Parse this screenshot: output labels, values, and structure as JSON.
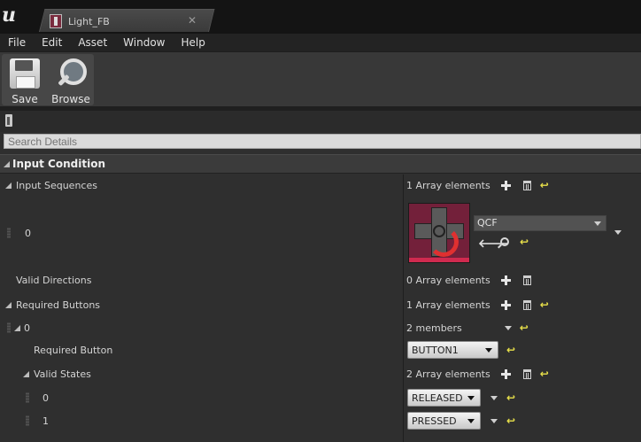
{
  "window": {
    "tab_title": "Light_FB",
    "close_glyph": "✕"
  },
  "menu": [
    "File",
    "Edit",
    "Asset",
    "Window",
    "Help"
  ],
  "toolbar": {
    "save_label": "Save",
    "browse_label": "Browse"
  },
  "details": {
    "search_placeholder": "Search Details",
    "category_title": "Input Condition"
  },
  "rows": {
    "input_sequences": {
      "label": "Input Sequences",
      "value": "1 Array elements"
    },
    "seq_0": {
      "index": "0",
      "asset_name": "QCF"
    },
    "valid_directions": {
      "label": "Valid Directions",
      "value": "0 Array elements"
    },
    "required_buttons": {
      "label": "Required Buttons",
      "value": "1 Array elements"
    },
    "rb_0": {
      "index": "0",
      "value": "2 members"
    },
    "required_button": {
      "label": "Required Button",
      "value": "BUTTON1"
    },
    "valid_states": {
      "label": "Valid States",
      "value": "2 Array elements"
    },
    "vs_0": {
      "index": "0",
      "value": "RELEASED"
    },
    "vs_1": {
      "index": "1",
      "value": "PRESSED"
    }
  },
  "icons": {
    "reset": "↩",
    "use_selected": "🡐"
  }
}
